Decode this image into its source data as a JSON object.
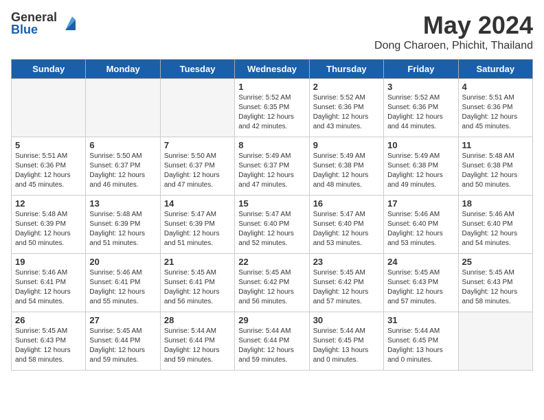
{
  "header": {
    "logo_general": "General",
    "logo_blue": "Blue",
    "month_title": "May 2024",
    "location": "Dong Charoen, Phichit, Thailand"
  },
  "days_of_week": [
    "Sunday",
    "Monday",
    "Tuesday",
    "Wednesday",
    "Thursday",
    "Friday",
    "Saturday"
  ],
  "weeks": [
    [
      {
        "day": "",
        "info": ""
      },
      {
        "day": "",
        "info": ""
      },
      {
        "day": "",
        "info": ""
      },
      {
        "day": "1",
        "info": "Sunrise: 5:52 AM\nSunset: 6:35 PM\nDaylight: 12 hours\nand 42 minutes."
      },
      {
        "day": "2",
        "info": "Sunrise: 5:52 AM\nSunset: 6:36 PM\nDaylight: 12 hours\nand 43 minutes."
      },
      {
        "day": "3",
        "info": "Sunrise: 5:52 AM\nSunset: 6:36 PM\nDaylight: 12 hours\nand 44 minutes."
      },
      {
        "day": "4",
        "info": "Sunrise: 5:51 AM\nSunset: 6:36 PM\nDaylight: 12 hours\nand 45 minutes."
      }
    ],
    [
      {
        "day": "5",
        "info": "Sunrise: 5:51 AM\nSunset: 6:36 PM\nDaylight: 12 hours\nand 45 minutes."
      },
      {
        "day": "6",
        "info": "Sunrise: 5:50 AM\nSunset: 6:37 PM\nDaylight: 12 hours\nand 46 minutes."
      },
      {
        "day": "7",
        "info": "Sunrise: 5:50 AM\nSunset: 6:37 PM\nDaylight: 12 hours\nand 47 minutes."
      },
      {
        "day": "8",
        "info": "Sunrise: 5:49 AM\nSunset: 6:37 PM\nDaylight: 12 hours\nand 47 minutes."
      },
      {
        "day": "9",
        "info": "Sunrise: 5:49 AM\nSunset: 6:38 PM\nDaylight: 12 hours\nand 48 minutes."
      },
      {
        "day": "10",
        "info": "Sunrise: 5:49 AM\nSunset: 6:38 PM\nDaylight: 12 hours\nand 49 minutes."
      },
      {
        "day": "11",
        "info": "Sunrise: 5:48 AM\nSunset: 6:38 PM\nDaylight: 12 hours\nand 50 minutes."
      }
    ],
    [
      {
        "day": "12",
        "info": "Sunrise: 5:48 AM\nSunset: 6:39 PM\nDaylight: 12 hours\nand 50 minutes."
      },
      {
        "day": "13",
        "info": "Sunrise: 5:48 AM\nSunset: 6:39 PM\nDaylight: 12 hours\nand 51 minutes."
      },
      {
        "day": "14",
        "info": "Sunrise: 5:47 AM\nSunset: 6:39 PM\nDaylight: 12 hours\nand 51 minutes."
      },
      {
        "day": "15",
        "info": "Sunrise: 5:47 AM\nSunset: 6:40 PM\nDaylight: 12 hours\nand 52 minutes."
      },
      {
        "day": "16",
        "info": "Sunrise: 5:47 AM\nSunset: 6:40 PM\nDaylight: 12 hours\nand 53 minutes."
      },
      {
        "day": "17",
        "info": "Sunrise: 5:46 AM\nSunset: 6:40 PM\nDaylight: 12 hours\nand 53 minutes."
      },
      {
        "day": "18",
        "info": "Sunrise: 5:46 AM\nSunset: 6:40 PM\nDaylight: 12 hours\nand 54 minutes."
      }
    ],
    [
      {
        "day": "19",
        "info": "Sunrise: 5:46 AM\nSunset: 6:41 PM\nDaylight: 12 hours\nand 54 minutes."
      },
      {
        "day": "20",
        "info": "Sunrise: 5:46 AM\nSunset: 6:41 PM\nDaylight: 12 hours\nand 55 minutes."
      },
      {
        "day": "21",
        "info": "Sunrise: 5:45 AM\nSunset: 6:41 PM\nDaylight: 12 hours\nand 56 minutes."
      },
      {
        "day": "22",
        "info": "Sunrise: 5:45 AM\nSunset: 6:42 PM\nDaylight: 12 hours\nand 56 minutes."
      },
      {
        "day": "23",
        "info": "Sunrise: 5:45 AM\nSunset: 6:42 PM\nDaylight: 12 hours\nand 57 minutes."
      },
      {
        "day": "24",
        "info": "Sunrise: 5:45 AM\nSunset: 6:43 PM\nDaylight: 12 hours\nand 57 minutes."
      },
      {
        "day": "25",
        "info": "Sunrise: 5:45 AM\nSunset: 6:43 PM\nDaylight: 12 hours\nand 58 minutes."
      }
    ],
    [
      {
        "day": "26",
        "info": "Sunrise: 5:45 AM\nSunset: 6:43 PM\nDaylight: 12 hours\nand 58 minutes."
      },
      {
        "day": "27",
        "info": "Sunrise: 5:45 AM\nSunset: 6:44 PM\nDaylight: 12 hours\nand 59 minutes."
      },
      {
        "day": "28",
        "info": "Sunrise: 5:44 AM\nSunset: 6:44 PM\nDaylight: 12 hours\nand 59 minutes."
      },
      {
        "day": "29",
        "info": "Sunrise: 5:44 AM\nSunset: 6:44 PM\nDaylight: 12 hours\nand 59 minutes."
      },
      {
        "day": "30",
        "info": "Sunrise: 5:44 AM\nSunset: 6:45 PM\nDaylight: 13 hours\nand 0 minutes."
      },
      {
        "day": "31",
        "info": "Sunrise: 5:44 AM\nSunset: 6:45 PM\nDaylight: 13 hours\nand 0 minutes."
      },
      {
        "day": "",
        "info": ""
      }
    ]
  ]
}
